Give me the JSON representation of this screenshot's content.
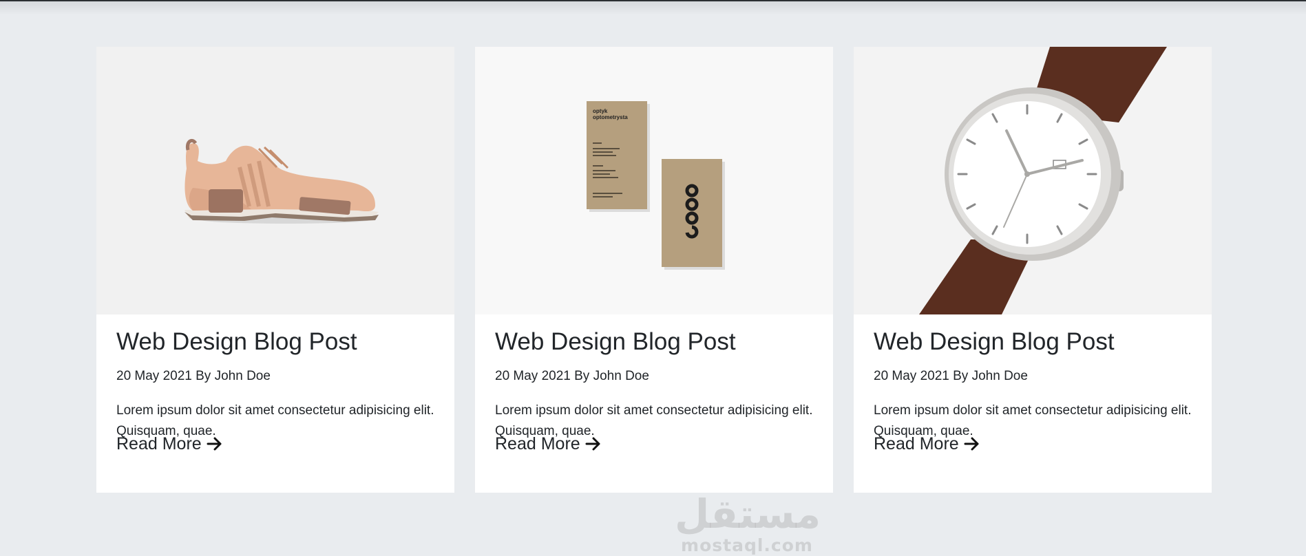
{
  "colors": {
    "page_background": "#e9ecef",
    "card_background": "#ffffff",
    "text": "#212529",
    "top_bar": "#2b2f33"
  },
  "posts": [
    {
      "image": "beige-sneaker-photo",
      "title": "Web Design Blog Post",
      "meta": "20 May 2021 By John Doe",
      "excerpt": "Lorem ipsum dolor sit amet consectetur adipisicing elit. Quisquam, quae.",
      "link_label": "Read More",
      "link_icon": "arrow-right-icon"
    },
    {
      "image": "kraft-business-cards-photo",
      "title": "Web Design Blog Post",
      "meta": "20 May 2021 By John Doe",
      "excerpt": "Lorem ipsum dolor sit amet consectetur adipisicing elit. Quisquam, quae.",
      "link_label": "Read More",
      "link_icon": "arrow-right-icon"
    },
    {
      "image": "wrist-watch-photo",
      "title": "Web Design Blog Post",
      "meta": "20 May 2021 By John Doe",
      "excerpt": "Lorem ipsum dolor sit amet consectetur adipisicing elit. Quisquam, quae.",
      "link_label": "Read More",
      "link_icon": "arrow-right-icon"
    }
  ],
  "business_card": {
    "heading_line1": "optyk",
    "heading_line2": "optometrysta"
  },
  "watermark": {
    "arabic": "مستقل",
    "latin": "mostaql.com"
  }
}
